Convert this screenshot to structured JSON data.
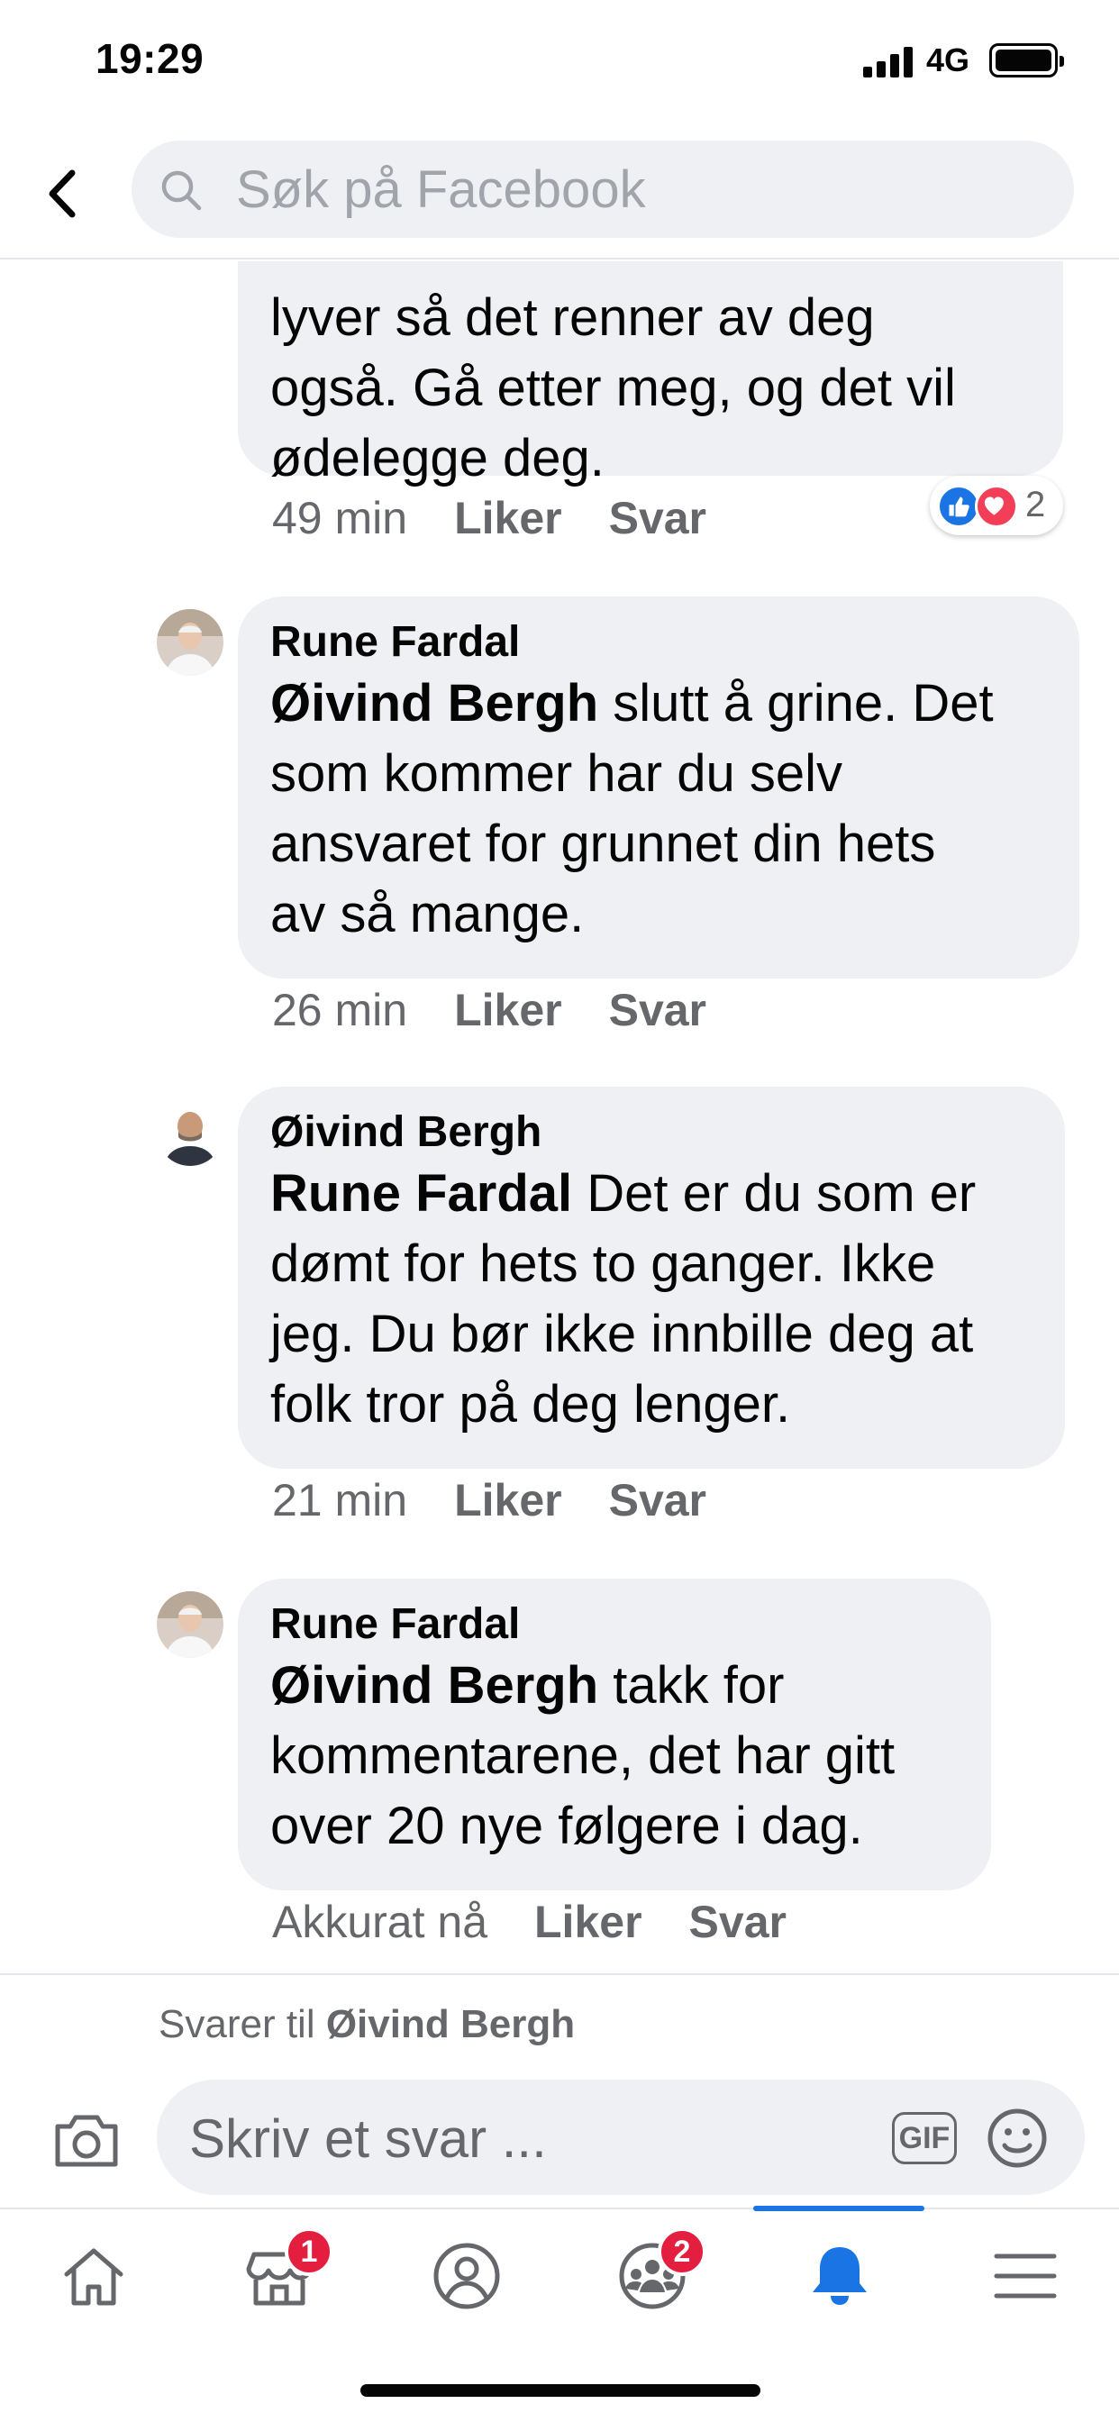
{
  "status_bar": {
    "time": "19:29",
    "network": "4G",
    "battery_level": 1.0
  },
  "header": {
    "search_placeholder": "Søk på Facebook",
    "icons": {
      "back": "chevron-left-icon",
      "search": "search-icon"
    }
  },
  "comments": [
    {
      "author": "",
      "mention": "",
      "text_lines": [
        "lyver så det renner av deg",
        "også. Gå etter meg, og det vil",
        "ødelegge deg."
      ],
      "time": "49 min",
      "like_label": "Liker",
      "reply_label": "Svar",
      "reaction_count": "2"
    },
    {
      "author": "Rune Fardal",
      "mention": "Øivind Bergh",
      "text_lines": [
        " slutt å grine. Det",
        "som kommer har du selv",
        "ansvaret for grunnet din hets",
        "av så mange."
      ],
      "time": "26 min",
      "like_label": "Liker",
      "reply_label": "Svar"
    },
    {
      "author": "Øivind Bergh",
      "mention": "Rune Fardal",
      "text_lines": [
        " Det er du som er",
        "dømt for hets to ganger. Ikke",
        "jeg. Du bør ikke innbille deg at",
        "folk tror på deg lenger."
      ],
      "time": "21 min",
      "like_label": "Liker",
      "reply_label": "Svar"
    },
    {
      "author": "Rune Fardal",
      "mention": "Øivind Bergh",
      "text_lines": [
        " takk for",
        "kommentarene, det har gitt",
        "over 20 nye følgere i dag."
      ],
      "time": "Akkurat nå",
      "like_label": "Liker",
      "reply_label": "Svar"
    }
  ],
  "composer": {
    "replying_prefix": "Svarer til ",
    "replying_name": "Øivind Bergh",
    "placeholder": "Skriv et svar ...",
    "gif_label": "GIF"
  },
  "tabbar": {
    "tabs": [
      {
        "name": "home",
        "icon": "home-icon",
        "badge": ""
      },
      {
        "name": "marketplace",
        "icon": "marketplace-icon",
        "badge": "1"
      },
      {
        "name": "profile",
        "icon": "profile-icon",
        "badge": ""
      },
      {
        "name": "groups",
        "icon": "groups-icon",
        "badge": "2"
      },
      {
        "name": "notifications",
        "icon": "bell-icon",
        "badge": "",
        "active": true
      },
      {
        "name": "menu",
        "icon": "menu-icon",
        "badge": ""
      }
    ]
  },
  "colors": {
    "accent": "#1b74e4",
    "bubble": "#eff0f3",
    "secondary_text": "#65676b",
    "badge": "#e41e3f"
  }
}
